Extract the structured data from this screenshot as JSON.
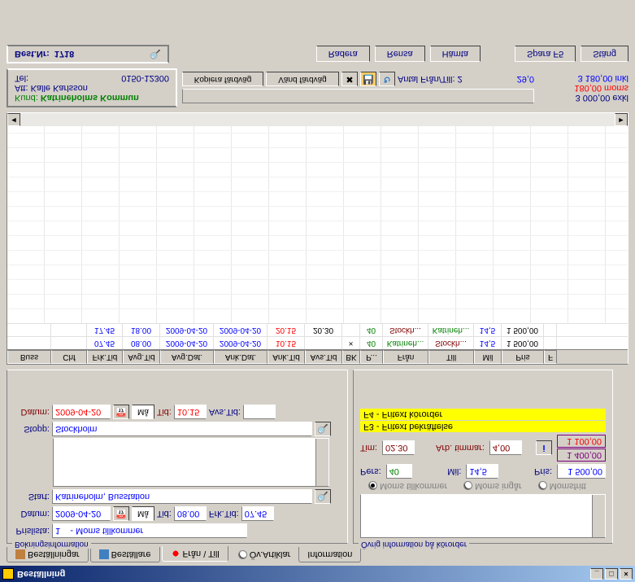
{
  "window": {
    "title": "Beställning"
  },
  "controls": {
    "min": "_",
    "max": "□",
    "close": "×"
  },
  "tabs": {
    "bestallningar": "Beställningar",
    "bestallare": "Beställare",
    "fran_till": "Från \\ Till",
    "ov_artiklar": "Öv.Artiklar",
    "information": "Information"
  },
  "left_panel": {
    "title": "Bokningsinformation",
    "prislista_label": "Prislista:",
    "prislista_value": "1    - Moms tillkommer",
    "datum_label": "Datum:",
    "datum1": "2009-04-20",
    "dag_btn": "Må",
    "tid_label": "Tid:",
    "tid1": "08.00",
    "frktid_label": "Frk.Tid:",
    "frktid": "07.45",
    "start_label": "Start:",
    "start": "Katrineholm, Busstation",
    "stopp_label": "Stopp:",
    "stopp": "Stockholm",
    "datum2": "2009-04-20",
    "tid2": "10.15",
    "avstid_label": "Avs.Tid:",
    "avstid": ""
  },
  "right_panel": {
    "title": "Övrig information på körorder",
    "moms1": "Moms tillkommer",
    "moms2": "Moms ingår",
    "moms3": "Momsfritt",
    "pers_label": "Pers:",
    "pers": "40",
    "mil_label": "Mil:",
    "mil": "14,5",
    "pris_label": "Pris:",
    "pris": "1 500,00",
    "tim_label": "Tim:",
    "tim": "02.30",
    "arb_label": "Arb. timmar:",
    "arb": "4,00",
    "box1": "1 400,00",
    "box2": "1 100,00",
    "f3": "F3 - Fritext bekräftelse",
    "f4": "F4 - Fritext körorder"
  },
  "grid": {
    "headers": [
      "Buss",
      "Chf",
      "Frk.Tid",
      "Avg.Tid",
      "Avg.Dat.",
      "Ank.Dat.",
      "Ank.Tid",
      "Avs.Tid",
      "BK",
      "P...",
      "Från",
      "Till",
      "Mil",
      "Pris",
      "F"
    ],
    "widths": [
      54,
      44,
      44,
      46,
      66,
      66,
      46,
      46,
      22,
      28,
      56,
      56,
      34,
      52,
      16
    ],
    "rows": [
      {
        "cells": [
          "",
          "",
          "07.45",
          "08.00",
          "2009-04-20",
          "2009-04-20",
          "10.15",
          "",
          "×",
          "40",
          "Katrineh...",
          "Stockh...",
          "14,5",
          "1 500,00",
          ""
        ],
        "colors": [
          "",
          "",
          "blue",
          "blue",
          "blue",
          "blue",
          "red",
          "",
          "",
          "green",
          "green",
          "maroon",
          "blue",
          "",
          ""
        ]
      },
      {
        "cells": [
          "",
          "",
          "17.45",
          "18.00",
          "2009-04-20",
          "2009-04-20",
          "20.15",
          "20.30",
          "",
          "40",
          "Stockh...",
          "Katrineh...",
          "14,5",
          "1 500,00",
          ""
        ],
        "colors": [
          "",
          "",
          "blue",
          "blue",
          "blue",
          "blue",
          "red",
          "",
          "",
          "green",
          "maroon",
          "green",
          "blue",
          "",
          ""
        ]
      }
    ]
  },
  "footer": {
    "kund_label": "Kund:",
    "kund": "Katrineholms Kommun",
    "att_label": "Att:",
    "att": "Kalle Karlsson",
    "tel_label": "Tel:",
    "tel": "0150-12300",
    "kopiera": "Kopiera färdväg",
    "vand": "Vänd färdväg",
    "antal": "Antal Från/Till: 2",
    "mil_total": "29,0",
    "exkl": "3 000,00 exkl",
    "moms": "180,00 moms",
    "inkl": "3 180,00 inkl"
  },
  "bottom": {
    "best_label": "Best.Nr:",
    "best": "1718",
    "radera": "Radera",
    "rensa": "Rensa",
    "hamta": "Hämta",
    "spara": "Spara F5",
    "stang": "Stäng"
  }
}
